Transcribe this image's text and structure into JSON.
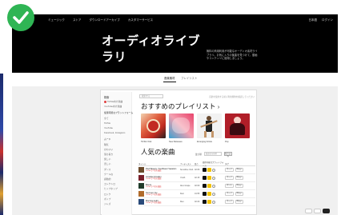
{
  "badge": {
    "icon": "check-icon",
    "color": "#2fb554"
  },
  "nav": {
    "items": [
      "ミュージック",
      "ストア",
      "ダウンロードアーカイブ",
      "カスタマーサービス"
    ],
    "right": [
      "日本語",
      "ログイン"
    ]
  },
  "hero": {
    "title_line1": "オーディオライブ",
    "title_line2": "ラリ",
    "description": "無料の商用利用が可能なオーディオ素材ライブラリ。お気に入りの楽曲を見つけて、動画やコンテンツに使用しましょう。"
  },
  "tabs": [
    "音楽素材",
    "プレイリスト"
  ],
  "sidebar": {
    "title": "検索",
    "items": [
      {
        "label": "TikTok向け楽曲",
        "type": "dot"
      },
      {
        "label": "YouTube向け楽曲",
        "type": "plain"
      },
      {
        "label": "使用可能なプラットフォーム",
        "type": "head"
      },
      {
        "label": "全て",
        "type": "plain"
      },
      {
        "label": "TikTok",
        "type": "plain"
      },
      {
        "label": "YouTube",
        "type": "plain"
      },
      {
        "label": "Facebook, Instagram",
        "type": "plain"
      },
      {
        "label": "ムード",
        "type": "head"
      },
      {
        "label": "陽気",
        "type": "plain"
      },
      {
        "label": "かわいい",
        "type": "plain"
      },
      {
        "label": "落ち着き",
        "type": "plain"
      },
      {
        "label": "楽しい",
        "type": "plain"
      },
      {
        "label": "悲しい",
        "type": "plain"
      },
      {
        "label": "ダンス",
        "type": "plain"
      },
      {
        "label": "クールな",
        "type": "plain"
      },
      {
        "label": "感動的",
        "type": "plain"
      },
      {
        "label": "エレクトロ",
        "type": "plain"
      },
      {
        "label": "ヒップホップ",
        "type": "plain"
      },
      {
        "label": "ロック",
        "type": "plain"
      },
      {
        "label": "ポップ",
        "type": "plain"
      },
      {
        "label": "ジャズ",
        "type": "plain"
      }
    ]
  },
  "main": {
    "search_placeholder": "検索する",
    "top_right": "音楽を使用する前に利用規約を確認してください",
    "playlists_title": "おすすめのプレイリスト",
    "chevron": "›",
    "playlists": [
      {
        "label": "TikTok Viral",
        "colors": [
          "#d23a2a",
          "#f0c7a0"
        ]
      },
      {
        "label": "New Releases",
        "colors": [
          "#e86a8a",
          "#5ab0d6"
        ]
      },
      {
        "label": "Emerging Artists",
        "colors": [
          "#f3f3f3",
          "#c79a6a"
        ]
      },
      {
        "label": "Pop",
        "colors": [
          "#b8222a",
          "#f4d7d0"
        ]
      }
    ],
    "popular_title": "人気の楽曲",
    "filter_label": "並び順",
    "filter_placeholder": "楽曲名を検索",
    "filter_button": "絞り込み",
    "table_headers": [
      "タイトル",
      "アーティスト",
      "長さ",
      "使用可能なプラットフォーム",
      "タグ"
    ],
    "rows": [
      {
        "title": "Pied Beauty / Sunflower Vacation",
        "sub": "TikTokで人気の楽曲",
        "artist": "Sunshine Club",
        "length": "02:06",
        "tags": [
          "ポップ",
          "明るい"
        ],
        "color": "#6b4a2a"
      },
      {
        "title": "Arcadia (Arcade)",
        "sub": "TikTokで人気の楽曲",
        "artist": "Youth",
        "length": "02:15",
        "tags": [
          "ポップ",
          "明るい"
        ],
        "color": "#7a1f2a"
      },
      {
        "title": "Bosss",
        "sub": "TikTokで人気の楽曲",
        "artist": "Alex Grape",
        "length": "02:09",
        "tags": [
          "ダンス",
          "明るい"
        ],
        "color": "#1f3b2a"
      },
      {
        "title": "Summer Joy",
        "sub": "TikTokで人気の楽曲",
        "artist": "Kiwi",
        "length": "01:55",
        "tags": [
          "ポップ",
          "明るい"
        ],
        "color": "#b06a2a"
      },
      {
        "title": "Morning Light",
        "sub": "TikTokで人気の楽曲",
        "artist": "Reo",
        "length": "02:20",
        "tags": [
          "ポップ",
          "明るい"
        ],
        "color": "#2a4a7a"
      }
    ]
  },
  "chips": [
    "prev",
    "next",
    "dark"
  ]
}
